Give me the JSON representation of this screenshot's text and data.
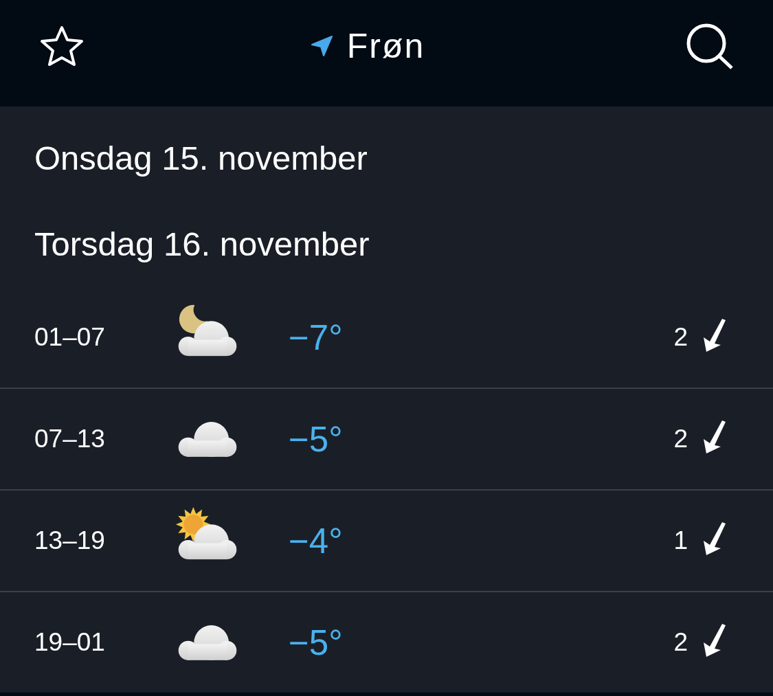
{
  "header": {
    "location": "Frøn"
  },
  "days": [
    {
      "title": "Onsdag 15. november"
    },
    {
      "title": "Torsdag 16. november",
      "periods": [
        {
          "time": "01–07",
          "kind": "cloud-moon",
          "temperature": "−7°",
          "wind": "2"
        },
        {
          "time": "07–13",
          "kind": "cloud",
          "temperature": "−5°",
          "wind": "2"
        },
        {
          "time": "13–19",
          "kind": "cloud-sun",
          "temperature": "−4°",
          "wind": "1"
        },
        {
          "time": "19–01",
          "kind": "cloud",
          "temperature": "−5°",
          "wind": "2"
        }
      ]
    }
  ]
}
